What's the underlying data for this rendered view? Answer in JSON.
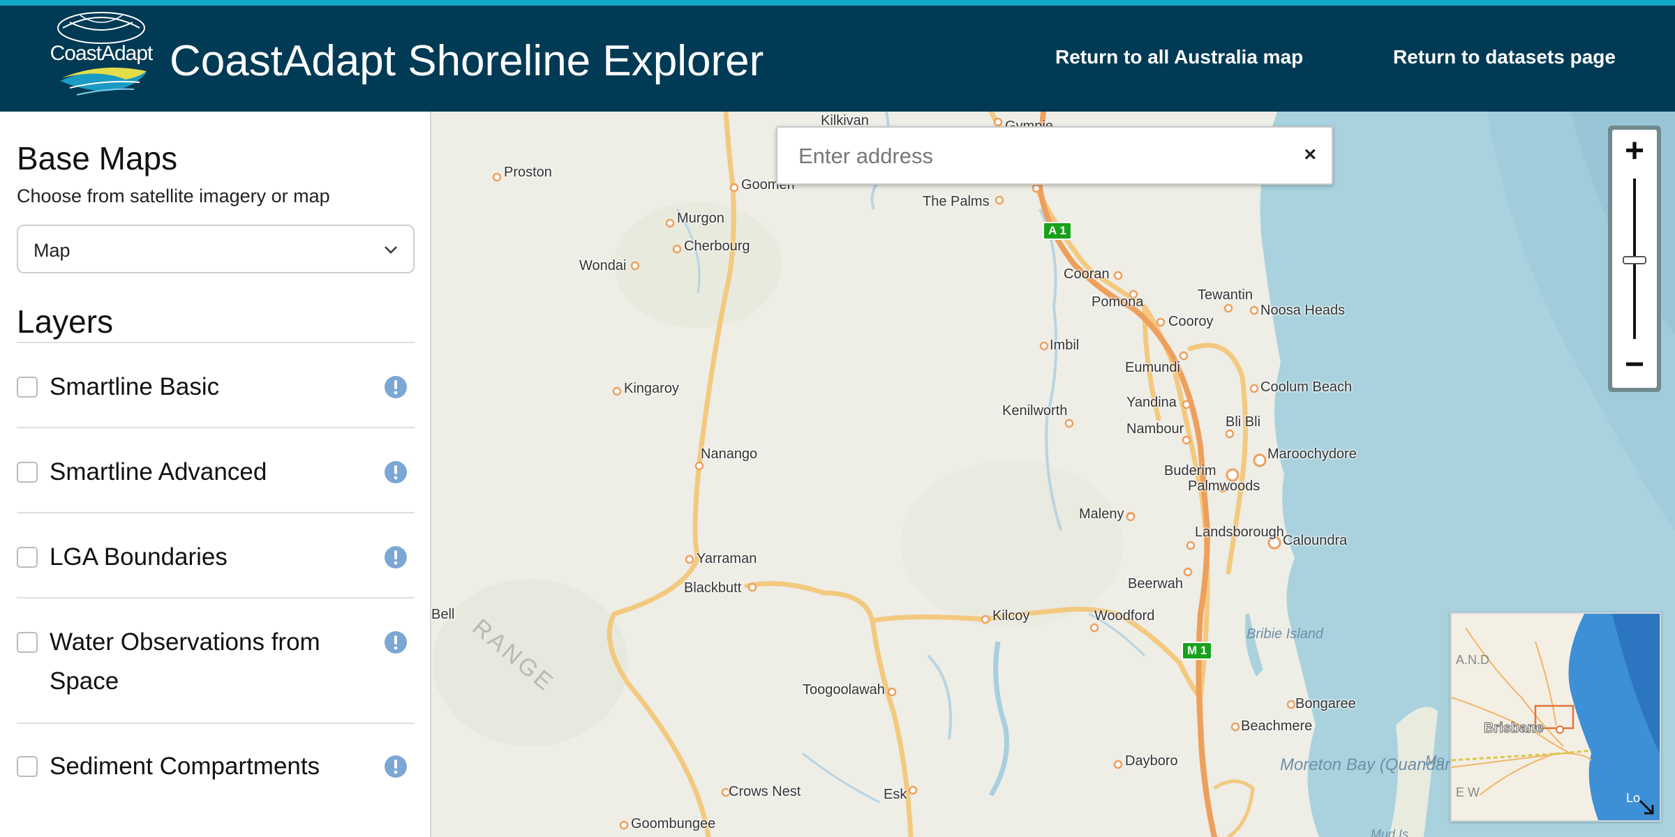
{
  "header": {
    "logo_text": "CoastAdapt",
    "title": "CoastAdapt Shoreline Explorer",
    "nav": [
      "Return to all Australia map",
      "Return to datasets page"
    ],
    "colors": {
      "bar": "#013a55",
      "accent": "#14a8c8"
    }
  },
  "sidebar": {
    "base_maps_heading": "Base Maps",
    "base_maps_subtitle": "Choose from satellite imagery or map",
    "base_map_selected": "Map",
    "layers_heading": "Layers",
    "layers": [
      {
        "label": "Smartline Basic",
        "checked": false
      },
      {
        "label": "Smartline Advanced",
        "checked": false
      },
      {
        "label": "LGA Boundaries",
        "checked": false
      },
      {
        "label": "Water Observations from Space",
        "checked": false
      },
      {
        "label": "Sediment Compartments",
        "checked": false
      }
    ]
  },
  "map": {
    "search_placeholder": "Enter address",
    "clear_glyph": "×",
    "zoom_in_glyph": "+",
    "zoom_out_glyph": "−",
    "places": [
      "Kilkivan",
      "Gympie",
      "Proston",
      "Goomeri",
      "The Palms",
      "Murgon",
      "Cherbourg",
      "Wondai",
      "Cooran",
      "Pomona",
      "Tewantin",
      "Noosa Heads",
      "Cooroy",
      "Imbil",
      "Eumundi",
      "Kingaroy",
      "Coolum Beach",
      "Yandina",
      "Kenilworth",
      "Nambour",
      "Bli Bli",
      "Nanango",
      "Maroochydore",
      "Buderim",
      "Palmwoods",
      "Maleny",
      "Landsborough",
      "Caloundra",
      "Yarraman",
      "Blackbutt",
      "Beerwah",
      "Bell",
      "Kilcoy",
      "Woodford",
      "Toogoolawah",
      "Bongaree",
      "Beachmere",
      "Dayboro",
      "Crows Nest",
      "Esk",
      "Goombungee"
    ],
    "road_shields": [
      "A 1",
      "M 1"
    ],
    "terrain_label": "RANGE",
    "water_labels": [
      "Bribie Island",
      "Moreton Bay (Quandamook)",
      "Mo",
      "Mud Is"
    ],
    "overview": {
      "labels": [
        "A.N.D",
        "Brisbane",
        "E W",
        "Lo"
      ]
    }
  }
}
